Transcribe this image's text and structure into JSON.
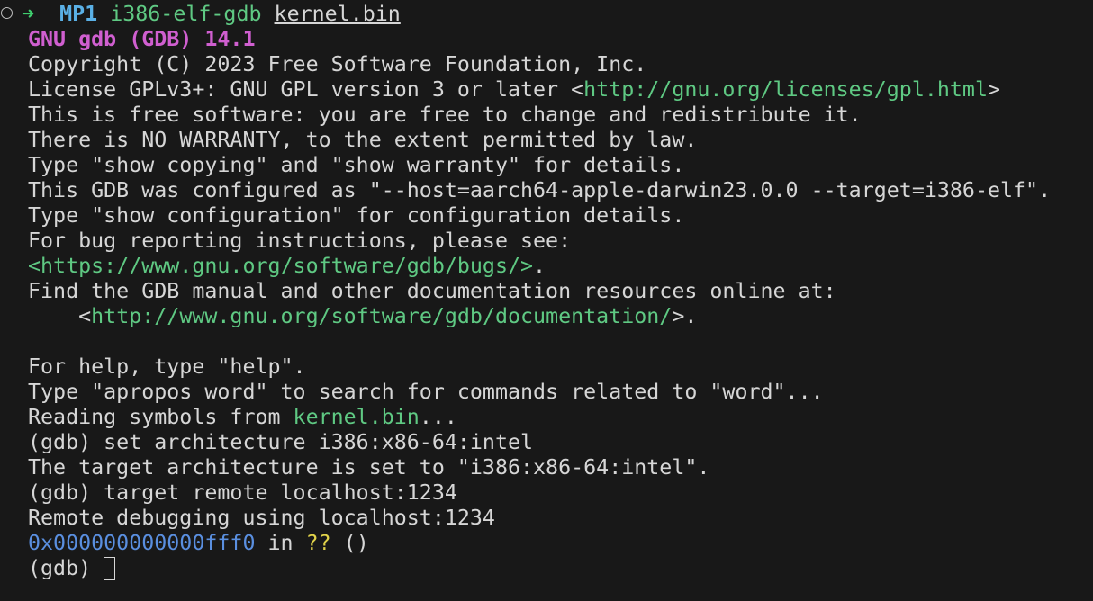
{
  "prompt": {
    "arrow": "➜",
    "directory": "MP1",
    "command": "i386-elf-gdb",
    "argument": "kernel.bin"
  },
  "output": {
    "banner": "GNU gdb (GDB) 14.1",
    "copyright": "Copyright (C) 2023 Free Software Foundation, Inc.",
    "license_prefix": "License GPLv3+: GNU GPL version 3 or later <",
    "license_url": "http://gnu.org/licenses/gpl.html",
    "license_suffix": ">",
    "free_software": "This is free software: you are free to change and redistribute it.",
    "no_warranty": "There is NO WARRANTY, to the extent permitted by law.",
    "show_copying": "Type \"show copying\" and \"show warranty\" for details.",
    "configured": "This GDB was configured as \"--host=aarch64-apple-darwin23.0.0 --target=i386-elf\".",
    "show_config": "Type \"show configuration\" for configuration details.",
    "bug_reporting": "For bug reporting instructions, please see:",
    "bugs_url": "<https://www.gnu.org/software/gdb/bugs/>",
    "bugs_suffix": ".",
    "manual": "Find the GDB manual and other documentation resources online at:",
    "doc_indent": "    <",
    "doc_url": "http://www.gnu.org/software/gdb/documentation/",
    "doc_suffix": ">.",
    "help": "For help, type \"help\".",
    "apropos": "Type \"apropos word\" to search for commands related to \"word\"...",
    "reading_prefix": "Reading symbols from ",
    "reading_file": "kernel.bin",
    "reading_suffix": "...",
    "cmd_set_arch": "(gdb) set architecture i386:x86-64:intel",
    "arch_result": "The target architecture is set to \"i386:x86-64:intel\".",
    "cmd_target": "(gdb) target remote localhost:1234",
    "remote_result": "Remote debugging using localhost:1234",
    "frame_addr": "0x000000000000fff0",
    "frame_in": " in ",
    "frame_func": "??",
    "frame_args": " ()",
    "final_prompt": "(gdb) "
  },
  "colors": {
    "background": "#181818",
    "foreground": "#d6d6d6",
    "green": "#5fc983",
    "blue": "#5a8fe0",
    "magenta": "#d05fd0",
    "yellow": "#e0d24a"
  }
}
